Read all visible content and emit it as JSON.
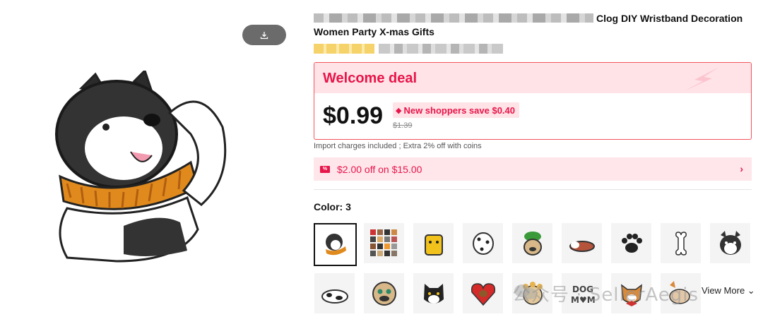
{
  "product": {
    "title_visible": "Clog DIY Wristband Decoration Women Party X-mas Gifts"
  },
  "deal": {
    "title": "Welcome deal",
    "price": "$0.99",
    "new_shopper_badge": "New shoppers save $0.40",
    "original_price": "$1.39"
  },
  "import_note": "Import charges included ; Extra 2% off with coins",
  "coupon": {
    "text": "$2.00 off on $15.00",
    "icon_label": "%"
  },
  "color": {
    "label": "Color: 3",
    "options": [
      "husky-scarf",
      "sticker-set",
      "yellow-dog",
      "dalmatian",
      "pug-frog-hat",
      "lying-dog",
      "paw-print",
      "bone",
      "husky-face",
      "cow-dog",
      "pug-face",
      "black-shiba",
      "heart-dog",
      "bulldog-flowers",
      "dog-mom-text",
      "corgi-bow",
      "corgi-lying"
    ],
    "view_more": "View More"
  },
  "watermark": "公众号 · SellerAegis",
  "colors": {
    "accent": "#e8154a",
    "deal_bg": "#ffe3e7",
    "border": "#f2545b"
  }
}
